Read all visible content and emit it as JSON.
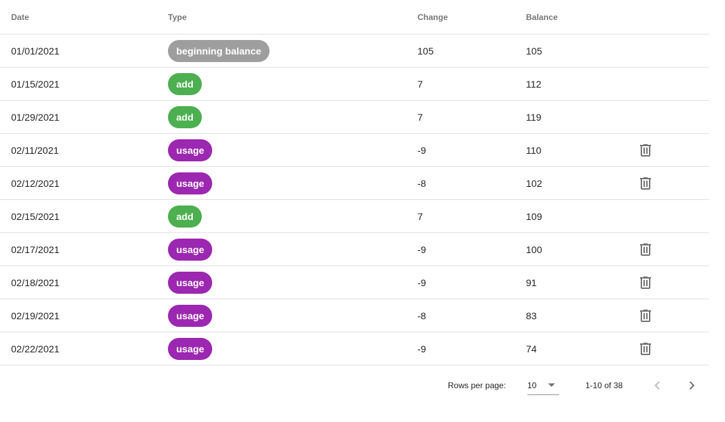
{
  "colors": {
    "beginning_balance": "#9e9e9e",
    "add": "#4caf50",
    "usage": "#9c27b0"
  },
  "columns": {
    "date": "Date",
    "type": "Type",
    "change": "Change",
    "balance": "Balance"
  },
  "rows": [
    {
      "date": "01/01/2021",
      "type": "beginning balance",
      "change": "105",
      "balance": "105",
      "deletable": false
    },
    {
      "date": "01/15/2021",
      "type": "add",
      "change": "7",
      "balance": "112",
      "deletable": false
    },
    {
      "date": "01/29/2021",
      "type": "add",
      "change": "7",
      "balance": "119",
      "deletable": false
    },
    {
      "date": "02/11/2021",
      "type": "usage",
      "change": "-9",
      "balance": "110",
      "deletable": true
    },
    {
      "date": "02/12/2021",
      "type": "usage",
      "change": "-8",
      "balance": "102",
      "deletable": true
    },
    {
      "date": "02/15/2021",
      "type": "add",
      "change": "7",
      "balance": "109",
      "deletable": false
    },
    {
      "date": "02/17/2021",
      "type": "usage",
      "change": "-9",
      "balance": "100",
      "deletable": true
    },
    {
      "date": "02/18/2021",
      "type": "usage",
      "change": "-9",
      "balance": "91",
      "deletable": true
    },
    {
      "date": "02/19/2021",
      "type": "usage",
      "change": "-8",
      "balance": "83",
      "deletable": true
    },
    {
      "date": "02/22/2021",
      "type": "usage",
      "change": "-9",
      "balance": "74",
      "deletable": true
    }
  ],
  "pagination": {
    "rows_per_page_label": "Rows per page:",
    "rows_per_page_value": "10",
    "range_label": "1-10 of 38",
    "prev_icon": "chevron-left-icon",
    "next_icon": "chevron-right-icon"
  }
}
